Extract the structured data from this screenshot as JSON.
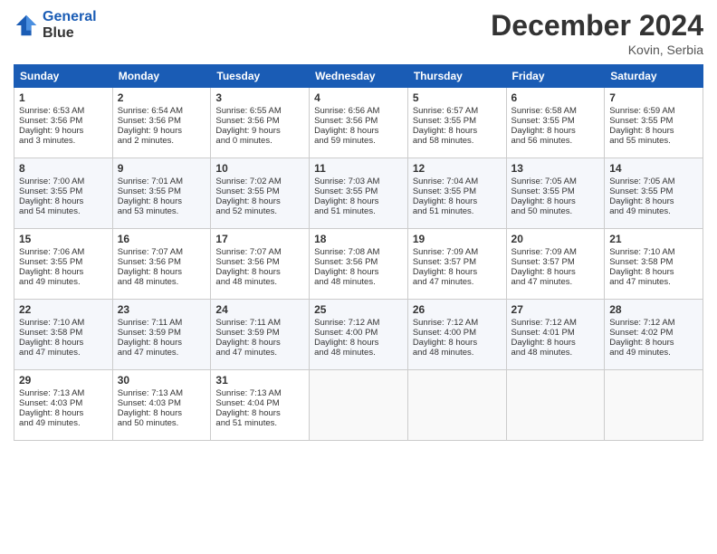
{
  "header": {
    "logo_line1": "General",
    "logo_line2": "Blue",
    "month_title": "December 2024",
    "location": "Kovin, Serbia"
  },
  "days_of_week": [
    "Sunday",
    "Monday",
    "Tuesday",
    "Wednesday",
    "Thursday",
    "Friday",
    "Saturday"
  ],
  "weeks": [
    [
      {
        "day": "1",
        "lines": [
          "Sunrise: 6:53 AM",
          "Sunset: 3:56 PM",
          "Daylight: 9 hours",
          "and 3 minutes."
        ]
      },
      {
        "day": "2",
        "lines": [
          "Sunrise: 6:54 AM",
          "Sunset: 3:56 PM",
          "Daylight: 9 hours",
          "and 2 minutes."
        ]
      },
      {
        "day": "3",
        "lines": [
          "Sunrise: 6:55 AM",
          "Sunset: 3:56 PM",
          "Daylight: 9 hours",
          "and 0 minutes."
        ]
      },
      {
        "day": "4",
        "lines": [
          "Sunrise: 6:56 AM",
          "Sunset: 3:56 PM",
          "Daylight: 8 hours",
          "and 59 minutes."
        ]
      },
      {
        "day": "5",
        "lines": [
          "Sunrise: 6:57 AM",
          "Sunset: 3:55 PM",
          "Daylight: 8 hours",
          "and 58 minutes."
        ]
      },
      {
        "day": "6",
        "lines": [
          "Sunrise: 6:58 AM",
          "Sunset: 3:55 PM",
          "Daylight: 8 hours",
          "and 56 minutes."
        ]
      },
      {
        "day": "7",
        "lines": [
          "Sunrise: 6:59 AM",
          "Sunset: 3:55 PM",
          "Daylight: 8 hours",
          "and 55 minutes."
        ]
      }
    ],
    [
      {
        "day": "8",
        "lines": [
          "Sunrise: 7:00 AM",
          "Sunset: 3:55 PM",
          "Daylight: 8 hours",
          "and 54 minutes."
        ]
      },
      {
        "day": "9",
        "lines": [
          "Sunrise: 7:01 AM",
          "Sunset: 3:55 PM",
          "Daylight: 8 hours",
          "and 53 minutes."
        ]
      },
      {
        "day": "10",
        "lines": [
          "Sunrise: 7:02 AM",
          "Sunset: 3:55 PM",
          "Daylight: 8 hours",
          "and 52 minutes."
        ]
      },
      {
        "day": "11",
        "lines": [
          "Sunrise: 7:03 AM",
          "Sunset: 3:55 PM",
          "Daylight: 8 hours",
          "and 51 minutes."
        ]
      },
      {
        "day": "12",
        "lines": [
          "Sunrise: 7:04 AM",
          "Sunset: 3:55 PM",
          "Daylight: 8 hours",
          "and 51 minutes."
        ]
      },
      {
        "day": "13",
        "lines": [
          "Sunrise: 7:05 AM",
          "Sunset: 3:55 PM",
          "Daylight: 8 hours",
          "and 50 minutes."
        ]
      },
      {
        "day": "14",
        "lines": [
          "Sunrise: 7:05 AM",
          "Sunset: 3:55 PM",
          "Daylight: 8 hours",
          "and 49 minutes."
        ]
      }
    ],
    [
      {
        "day": "15",
        "lines": [
          "Sunrise: 7:06 AM",
          "Sunset: 3:55 PM",
          "Daylight: 8 hours",
          "and 49 minutes."
        ]
      },
      {
        "day": "16",
        "lines": [
          "Sunrise: 7:07 AM",
          "Sunset: 3:56 PM",
          "Daylight: 8 hours",
          "and 48 minutes."
        ]
      },
      {
        "day": "17",
        "lines": [
          "Sunrise: 7:07 AM",
          "Sunset: 3:56 PM",
          "Daylight: 8 hours",
          "and 48 minutes."
        ]
      },
      {
        "day": "18",
        "lines": [
          "Sunrise: 7:08 AM",
          "Sunset: 3:56 PM",
          "Daylight: 8 hours",
          "and 48 minutes."
        ]
      },
      {
        "day": "19",
        "lines": [
          "Sunrise: 7:09 AM",
          "Sunset: 3:57 PM",
          "Daylight: 8 hours",
          "and 47 minutes."
        ]
      },
      {
        "day": "20",
        "lines": [
          "Sunrise: 7:09 AM",
          "Sunset: 3:57 PM",
          "Daylight: 8 hours",
          "and 47 minutes."
        ]
      },
      {
        "day": "21",
        "lines": [
          "Sunrise: 7:10 AM",
          "Sunset: 3:58 PM",
          "Daylight: 8 hours",
          "and 47 minutes."
        ]
      }
    ],
    [
      {
        "day": "22",
        "lines": [
          "Sunrise: 7:10 AM",
          "Sunset: 3:58 PM",
          "Daylight: 8 hours",
          "and 47 minutes."
        ]
      },
      {
        "day": "23",
        "lines": [
          "Sunrise: 7:11 AM",
          "Sunset: 3:59 PM",
          "Daylight: 8 hours",
          "and 47 minutes."
        ]
      },
      {
        "day": "24",
        "lines": [
          "Sunrise: 7:11 AM",
          "Sunset: 3:59 PM",
          "Daylight: 8 hours",
          "and 47 minutes."
        ]
      },
      {
        "day": "25",
        "lines": [
          "Sunrise: 7:12 AM",
          "Sunset: 4:00 PM",
          "Daylight: 8 hours",
          "and 48 minutes."
        ]
      },
      {
        "day": "26",
        "lines": [
          "Sunrise: 7:12 AM",
          "Sunset: 4:00 PM",
          "Daylight: 8 hours",
          "and 48 minutes."
        ]
      },
      {
        "day": "27",
        "lines": [
          "Sunrise: 7:12 AM",
          "Sunset: 4:01 PM",
          "Daylight: 8 hours",
          "and 48 minutes."
        ]
      },
      {
        "day": "28",
        "lines": [
          "Sunrise: 7:12 AM",
          "Sunset: 4:02 PM",
          "Daylight: 8 hours",
          "and 49 minutes."
        ]
      }
    ],
    [
      {
        "day": "29",
        "lines": [
          "Sunrise: 7:13 AM",
          "Sunset: 4:03 PM",
          "Daylight: 8 hours",
          "and 49 minutes."
        ]
      },
      {
        "day": "30",
        "lines": [
          "Sunrise: 7:13 AM",
          "Sunset: 4:03 PM",
          "Daylight: 8 hours",
          "and 50 minutes."
        ]
      },
      {
        "day": "31",
        "lines": [
          "Sunrise: 7:13 AM",
          "Sunset: 4:04 PM",
          "Daylight: 8 hours",
          "and 51 minutes."
        ]
      },
      null,
      null,
      null,
      null
    ]
  ]
}
